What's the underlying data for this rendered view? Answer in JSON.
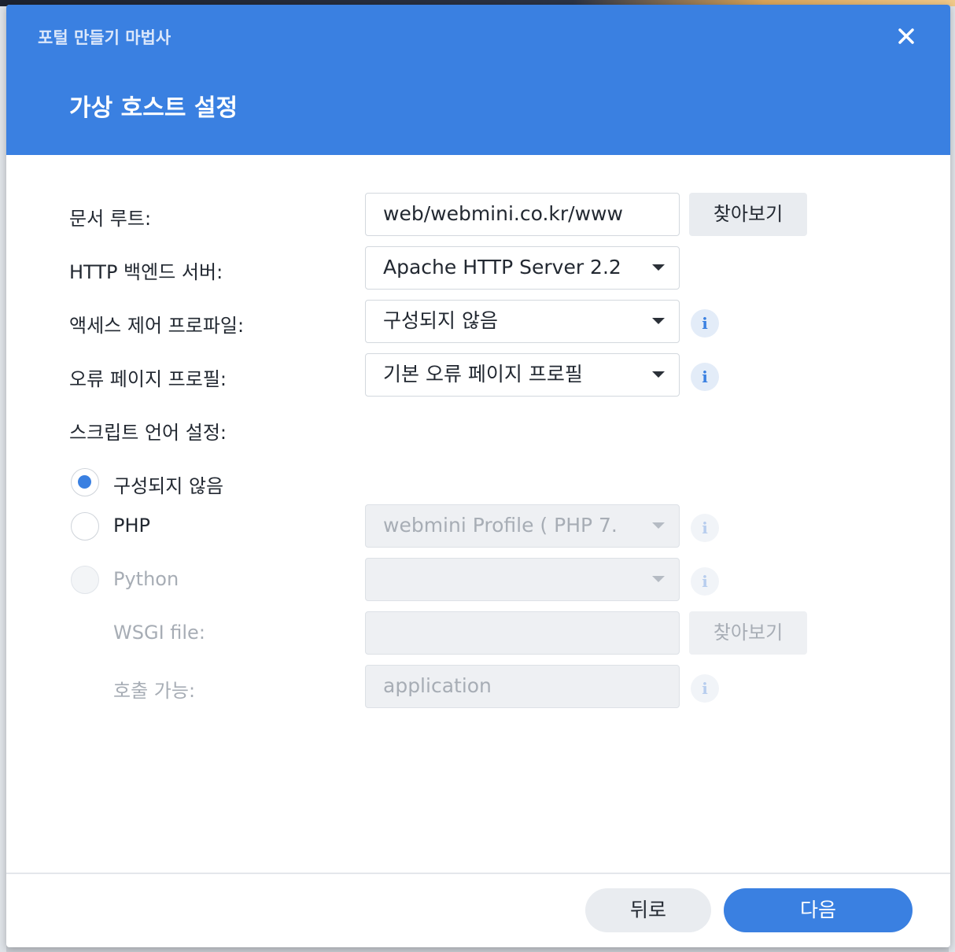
{
  "window": {
    "wizard_title": "포털 만들기 마법사",
    "step_title": "가상 호스트 설정",
    "close_label": "✕"
  },
  "form": {
    "document_root": {
      "label": "문서 루트:",
      "value": "web/webmini.co.kr/www",
      "browse_label": "찾아보기"
    },
    "http_backend": {
      "label": "HTTP 백엔드 서버:",
      "value": "Apache HTTP Server 2.2"
    },
    "access_control": {
      "label": "액세스 제어 프로파일:",
      "value": "구성되지 않음",
      "info_icon": "i"
    },
    "error_page": {
      "label": "오류 페이지 프로필:",
      "value": "기본 오류 페이지 프로필",
      "info_icon": "i"
    },
    "script_language": {
      "label": "스크립트 언어 설정:",
      "options": [
        {
          "label": "구성되지 않음",
          "checked": true,
          "enabled": true
        },
        {
          "label": "PHP",
          "checked": false,
          "enabled": true
        },
        {
          "label": "Python",
          "checked": false,
          "enabled": false
        }
      ],
      "php_profile": "webmini Profile ( PHP 7.",
      "python_value": "",
      "info_icon": "i"
    },
    "wsgi_file": {
      "label": "WSGI file:",
      "value": "",
      "browse_label": "찾아보기"
    },
    "callable": {
      "label": "호출 가능:",
      "placeholder": "application",
      "info_icon": "i"
    }
  },
  "footer": {
    "back_label": "뒤로",
    "next_label": "다음"
  },
  "colors": {
    "accent": "#3a80e1",
    "header_bg": "#3a80e1",
    "disabled_text": "#a7adb5"
  }
}
